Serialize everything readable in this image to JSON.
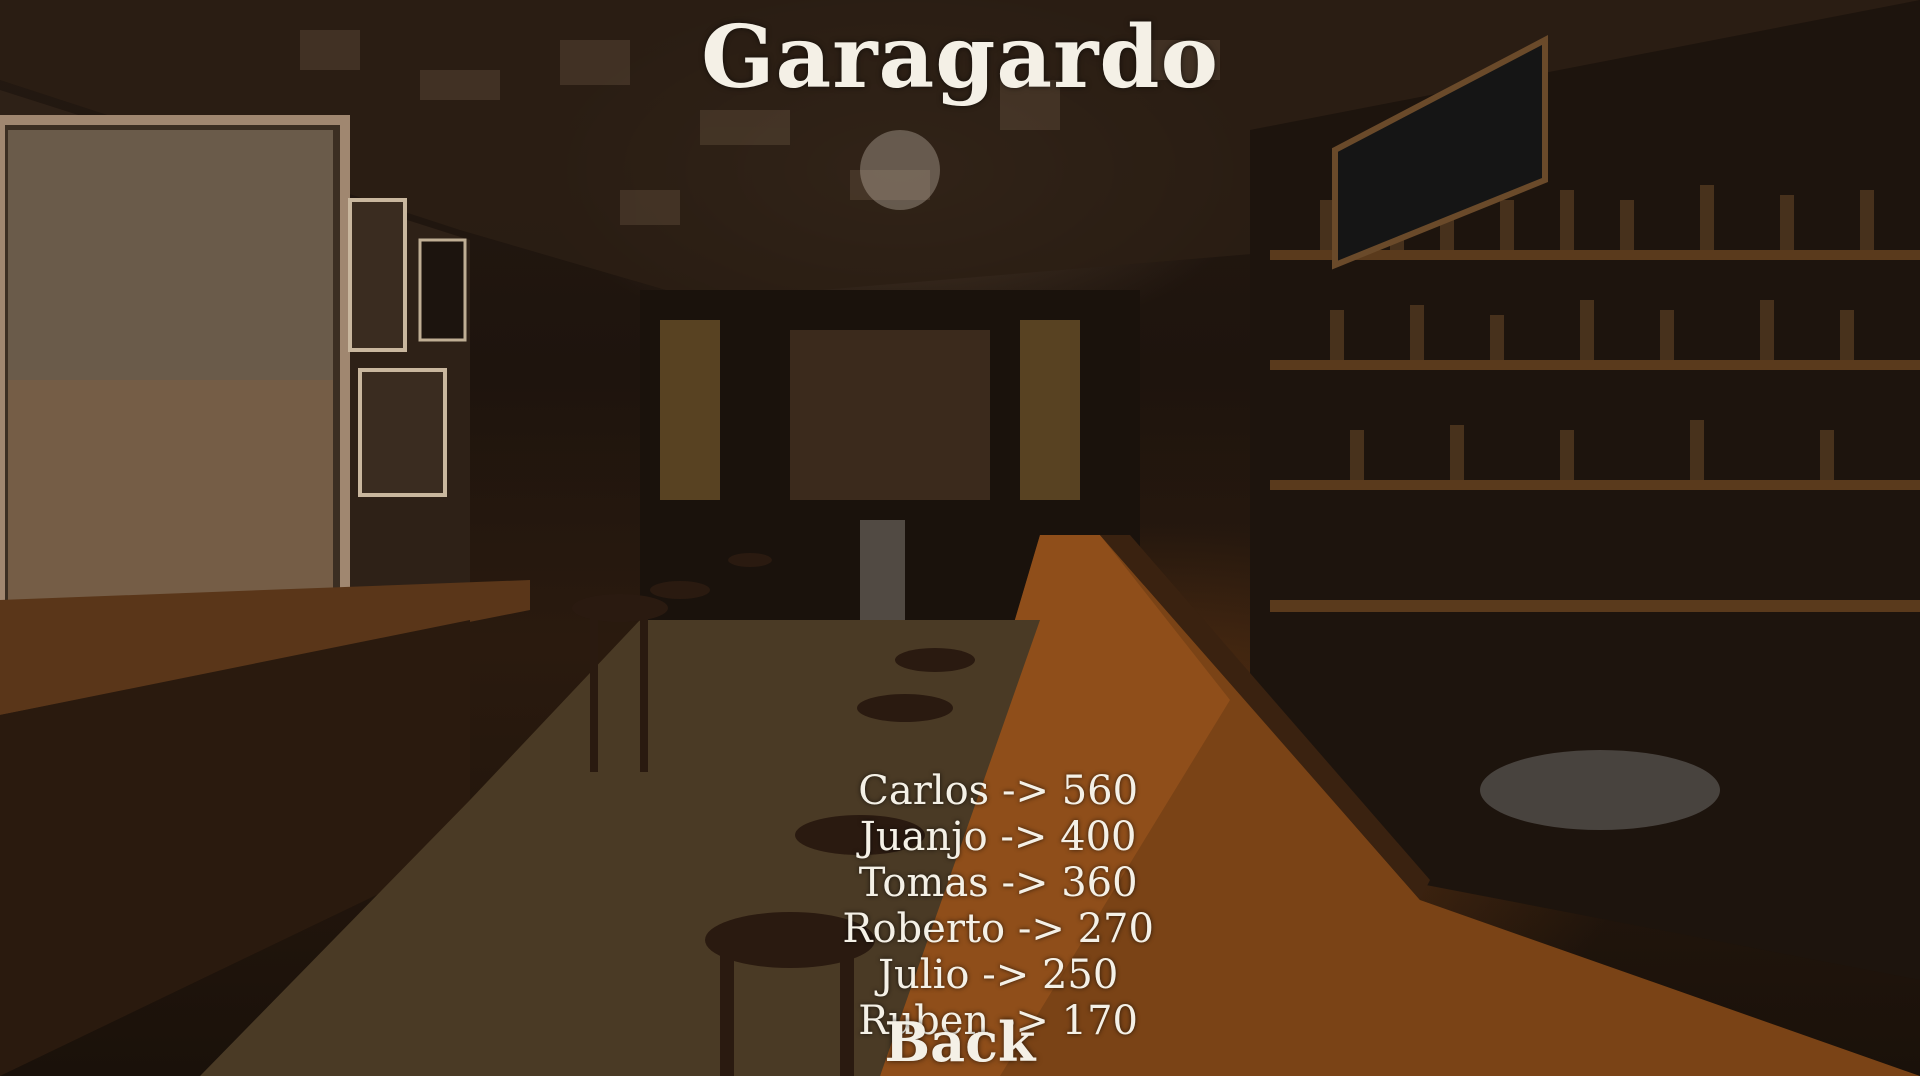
{
  "title": "Garagardo",
  "scores": [
    {
      "name": "Carlos",
      "separator": "->",
      "score": 560
    },
    {
      "name": "Juanjo",
      "separator": "->",
      "score": 400
    },
    {
      "name": "Tomas",
      "separator": "->",
      "score": 360
    },
    {
      "name": "Roberto",
      "separator": "->",
      "score": 270
    },
    {
      "name": "Julio",
      "separator": "->",
      "score": 250
    },
    {
      "name": "Ruben",
      "separator": "->",
      "score": 170
    }
  ],
  "back_label": "Back",
  "colors": {
    "text": "#f4f0e6",
    "background_dark": "#1e140d",
    "bar_wood": "#6b3a17"
  }
}
